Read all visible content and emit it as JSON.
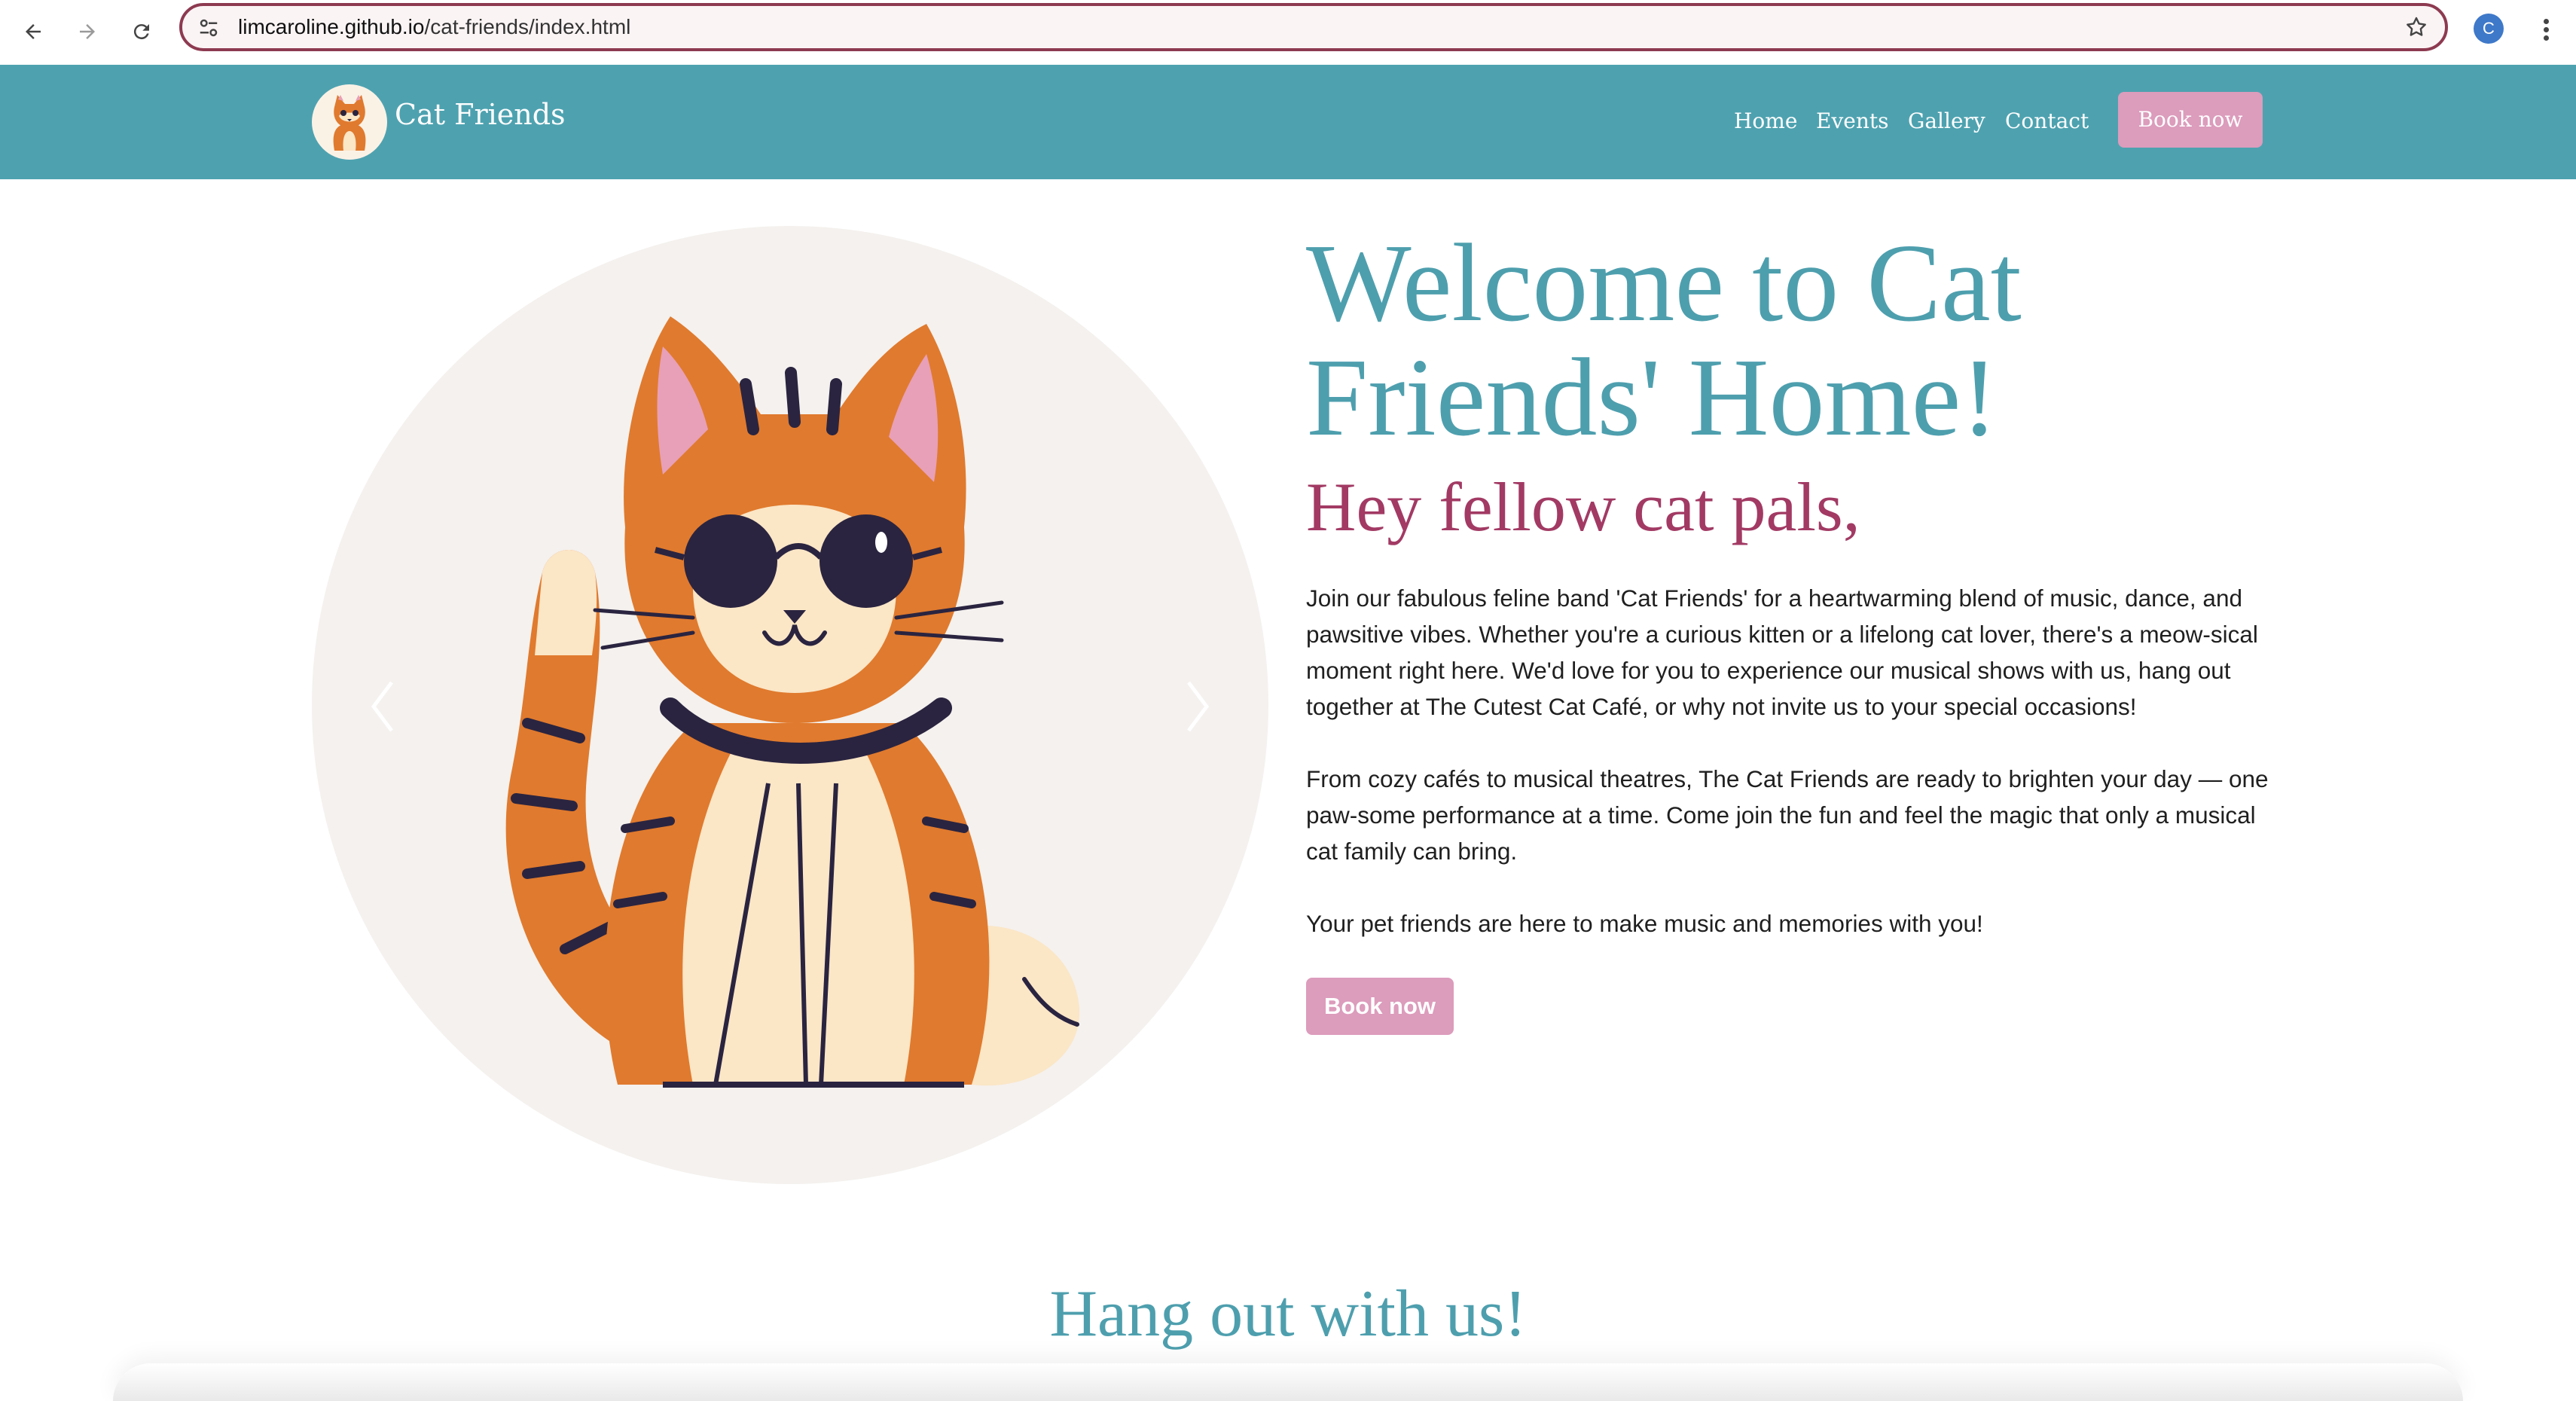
{
  "browser": {
    "url_host": "limcaroline.github.io",
    "url_path": "/cat-friends/index.html",
    "profile_initial": "C",
    "icons": [
      "back-arrow-icon",
      "forward-arrow-icon",
      "reload-icon",
      "site-settings-icon",
      "bookmark-star-icon",
      "kebab-menu-icon"
    ]
  },
  "header": {
    "brand": "Cat Friends",
    "nav": [
      "Home",
      "Events",
      "Gallery",
      "Contact"
    ],
    "book_label": "Book now"
  },
  "hero": {
    "title": "Welcome to Cat Friends' Home!",
    "subtitle": "Hey fellow cat pals,",
    "paragraphs": [
      "Join our fabulous feline band 'Cat Friends' for a heartwarming blend of music, dance, and pawsitive vibes. Whether you're a curious kitten or a lifelong cat lover, there's a meow-sical moment right here. We'd love for you to experience our musical shows with us, hang out together at The Cutest Cat Café, or why not invite us to your special occasions!",
      "From cozy cafés to musical theatres, The Cat Friends are ready to brighten your day — one paw-some performance at a time. Come join the fun and feel the magic that only a musical cat family can bring.",
      "Your pet friends are here to make music and memories with you!"
    ],
    "book_label": "Book now"
  },
  "section": {
    "title": "Hang out with us!"
  },
  "colors": {
    "header_bg": "#4ea2b0",
    "accent_teal": "#4e9fae",
    "accent_magenta": "#a23a64",
    "button_pink": "#dc9cbc",
    "cat_orange": "#e07a2e",
    "cat_cream": "#fbe6c6"
  }
}
